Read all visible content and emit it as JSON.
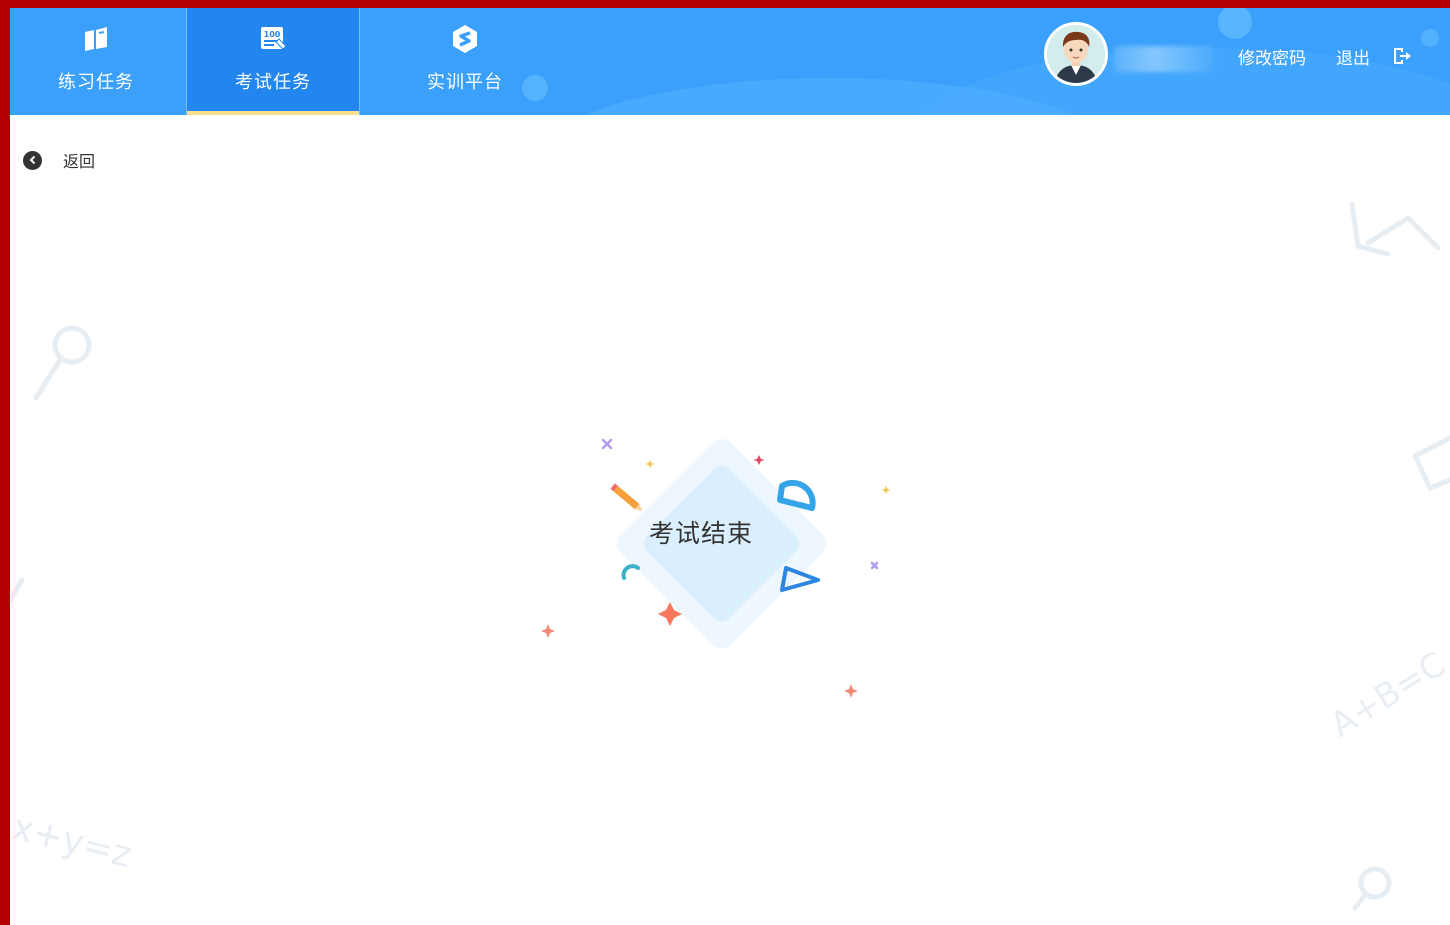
{
  "nav": {
    "tabs": [
      {
        "label": "练习任务",
        "icon": "practice-book-icon"
      },
      {
        "label": "考试任务",
        "icon": "exam-score-icon",
        "active": true
      },
      {
        "label": "实训平台",
        "icon": "training-s-icon"
      }
    ]
  },
  "user": {
    "change_password": "修改密码",
    "logout": "退出"
  },
  "page": {
    "back_label": "返回",
    "result_message": "考试结束"
  },
  "colors": {
    "header": "#3aa0fb",
    "active_tab": "#2386ee",
    "active_underline": "#f8e08a",
    "frame_border": "#b30000"
  }
}
